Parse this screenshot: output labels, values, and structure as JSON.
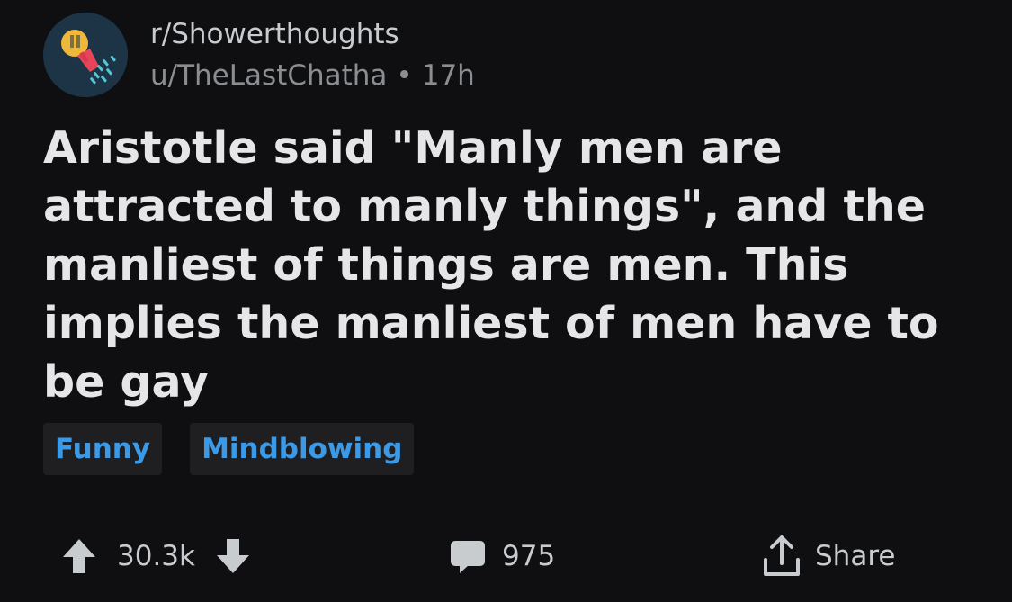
{
  "post": {
    "subreddit": "r/Showerthoughts",
    "author": "u/TheLastChatha",
    "separator": "•",
    "age": "17h",
    "title": "Aristotle said \"Manly men are attracted to manly things\", and the manliest of things are men. This implies the manliest of men have to be gay",
    "flairs": [
      {
        "label": "Funny"
      },
      {
        "label": "Mindblowing"
      }
    ]
  },
  "actions": {
    "score": "30.3k",
    "comments": "975",
    "share_label": "Share"
  },
  "icons": {
    "avatar": "subreddit-avatar-lightbulb-shower",
    "upvote": "arrow-up-icon",
    "downvote": "arrow-down-icon",
    "comment": "comment-bubble-icon",
    "share": "share-icon"
  },
  "colors": {
    "background": "#0f0f11",
    "flair_text": "#3b9ae8",
    "flair_background": "#1f1f22"
  }
}
